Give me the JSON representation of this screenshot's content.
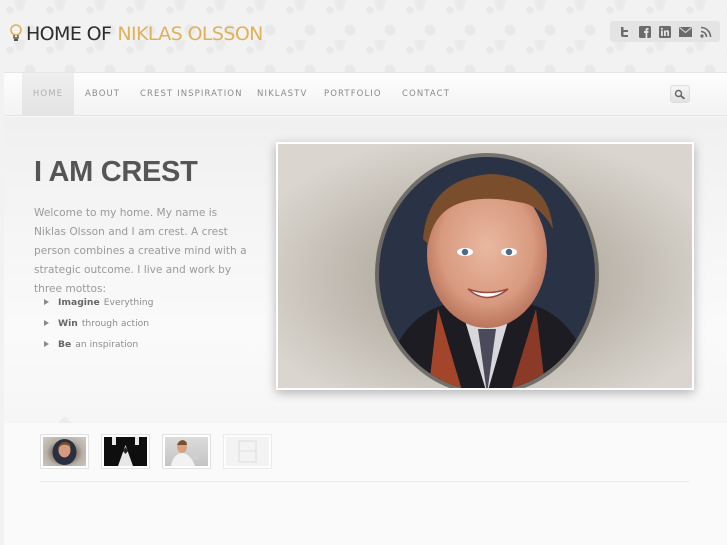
{
  "logo": {
    "home": "HOME OF",
    "name": "NIKLAS OLSSON"
  },
  "social": [
    {
      "icon": "twitter-icon"
    },
    {
      "icon": "facebook-icon"
    },
    {
      "icon": "linkedin-icon"
    },
    {
      "icon": "email-icon"
    },
    {
      "icon": "rss-icon"
    }
  ],
  "nav": {
    "items": [
      {
        "label": "HOME",
        "active": true
      },
      {
        "label": "ABOUT"
      },
      {
        "label": "CREST INSPIRATION"
      },
      {
        "label": "NIKLASTV"
      },
      {
        "label": "PORTFOLIO"
      },
      {
        "label": "CONTACT"
      }
    ],
    "search_icon": "search-icon"
  },
  "hero": {
    "title": "I AM CREST",
    "intro": "Welcome to my home. My name is Niklas Olsson and I am crest. A crest person combines a creative mind with a strategic outcome. I live and work by three mottos:",
    "mottos": [
      {
        "bold": "Imagine",
        "rest": "Everything"
      },
      {
        "bold": "Win",
        "rest": "through action"
      },
      {
        "bold": "Be",
        "rest": "an inspiration"
      }
    ]
  },
  "colors": {
    "accent": "#e0b15a",
    "text_dark": "#555555",
    "text_muted": "#9a9a9a"
  }
}
